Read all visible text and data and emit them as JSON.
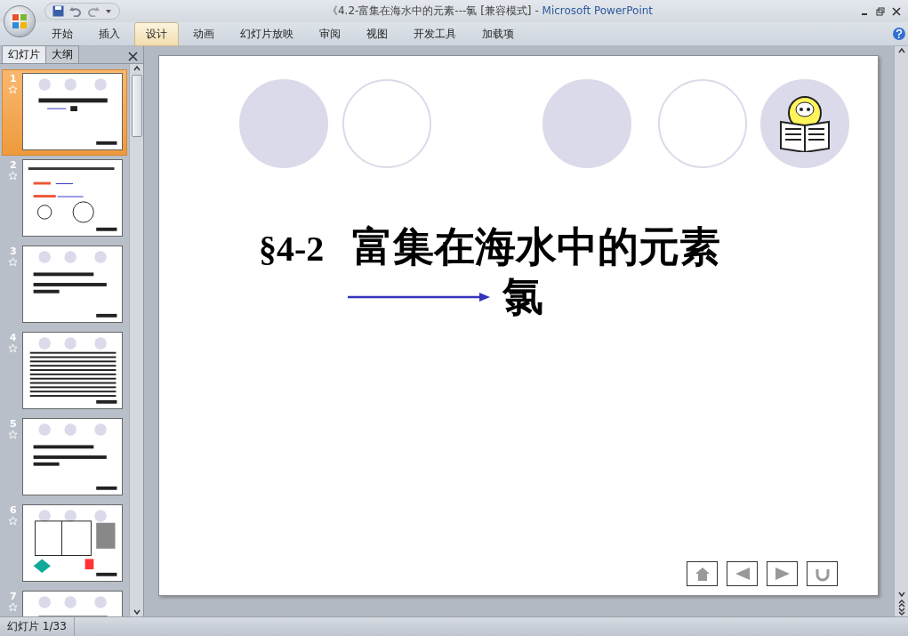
{
  "window": {
    "document": "《4.2-富集在海水中的元素---氯 [兼容模式]",
    "separator": "-",
    "app": "Microsoft PowerPoint"
  },
  "ribbon_tabs": [
    {
      "label": "开始",
      "selected": false
    },
    {
      "label": "插入",
      "selected": false
    },
    {
      "label": "设计",
      "selected": true
    },
    {
      "label": "动画",
      "selected": false
    },
    {
      "label": "幻灯片放映",
      "selected": false
    },
    {
      "label": "审阅",
      "selected": false
    },
    {
      "label": "视图",
      "selected": false
    },
    {
      "label": "开发工具",
      "selected": false
    },
    {
      "label": "加载项",
      "selected": false
    }
  ],
  "panel_tabs": [
    {
      "label": "幻灯片",
      "selected": true
    },
    {
      "label": "大纲",
      "selected": false
    }
  ],
  "thumbnails": [
    {
      "number": "1",
      "selected": true,
      "kind": "title"
    },
    {
      "number": "2",
      "selected": false,
      "kind": "diagram"
    },
    {
      "number": "3",
      "selected": false,
      "kind": "text"
    },
    {
      "number": "4",
      "selected": false,
      "kind": "dense"
    },
    {
      "number": "5",
      "selected": false,
      "kind": "text"
    },
    {
      "number": "6",
      "selected": false,
      "kind": "table"
    },
    {
      "number": "7",
      "selected": false,
      "kind": "title"
    }
  ],
  "slide": {
    "section": "§4-2",
    "title": "富集在海水中的元素",
    "subtitle": "氯"
  },
  "status_bar": {
    "slide_counter": "幻灯片 1/33"
  }
}
